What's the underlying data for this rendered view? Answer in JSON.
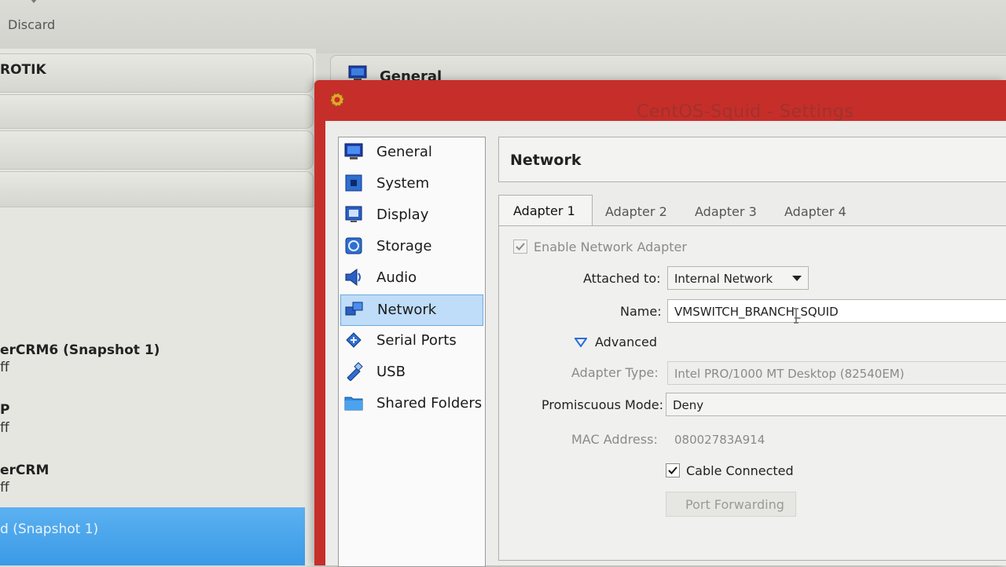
{
  "manager": {
    "toolbar": {
      "discard_label": "Discard"
    },
    "vm_list": [
      {
        "name": "ROTIK",
        "state": ""
      },
      {
        "name": "erCRM6 (Snapshot 1)",
        "state": "ff"
      },
      {
        "name": "P",
        "state": "ff"
      },
      {
        "name": "erCRM",
        "state": "ff"
      },
      {
        "name": "d (Snapshot 1)",
        "state": "",
        "selected": true
      }
    ],
    "details_tab": {
      "label": "General"
    }
  },
  "dialog": {
    "title": "CentOS-Squid - Settings",
    "categories": [
      {
        "label": "General",
        "icon": "monitor-icon"
      },
      {
        "label": "System",
        "icon": "chip-icon"
      },
      {
        "label": "Display",
        "icon": "display-icon"
      },
      {
        "label": "Storage",
        "icon": "disk-icon"
      },
      {
        "label": "Audio",
        "icon": "speaker-icon"
      },
      {
        "label": "Network",
        "icon": "network-icon",
        "active": true
      },
      {
        "label": "Serial Ports",
        "icon": "serial-port-icon"
      },
      {
        "label": "USB",
        "icon": "usb-icon"
      },
      {
        "label": "Shared Folders",
        "icon": "folder-icon"
      }
    ],
    "network": {
      "heading": "Network",
      "tabs": [
        "Adapter 1",
        "Adapter 2",
        "Adapter 3",
        "Adapter 4"
      ],
      "active_tab": "Adapter 1",
      "enable_adapter": {
        "label": "Enable Network Adapter",
        "checked": true
      },
      "attached_to": {
        "label": "Attached to:",
        "value": "Internal Network"
      },
      "name": {
        "label": "Name:",
        "value": "VMSWITCH_BRANCH_SQUID"
      },
      "advanced": {
        "label": "Advanced"
      },
      "adapter_type": {
        "label": "Adapter Type:",
        "value": "Intel PRO/1000 MT Desktop (82540EM)"
      },
      "promiscuous_mode": {
        "label": "Promiscuous Mode:",
        "value": "Deny"
      },
      "mac_address": {
        "label": "MAC Address:",
        "value": "08002783A914"
      },
      "cable_connected": {
        "label": "Cable Connected",
        "checked": true
      },
      "port_forwarding": {
        "label": "Port Forwarding"
      }
    }
  },
  "colors": {
    "title_bar": "#c62e2a",
    "selection": "#bfdcf8",
    "vm_selected": "#3a9ae6"
  }
}
